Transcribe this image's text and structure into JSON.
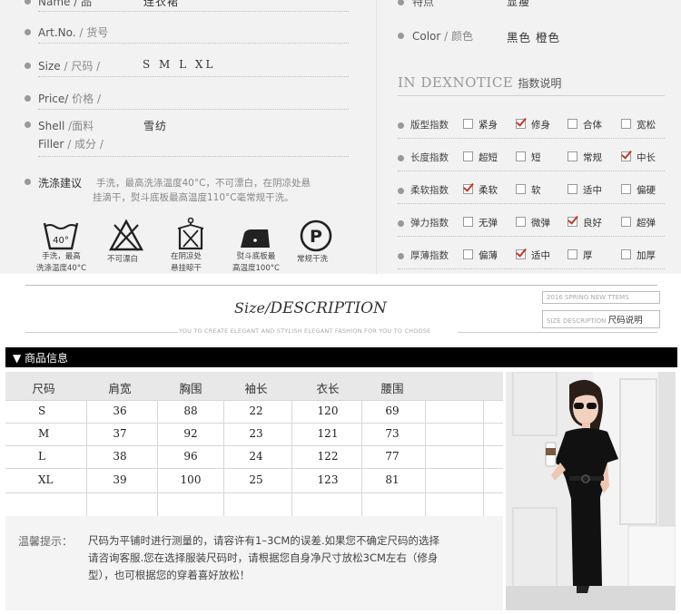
{
  "details": {
    "name_label": "Name / 品",
    "name_value": "连衣裙",
    "artno_label": "Art.No.",
    "artno_cn": "/ 货号",
    "size_label": "Size",
    "size_cn": "/ 尺码 /",
    "size_value": "S M L XL",
    "price_label": "Price/",
    "price_cn": "价格 /",
    "shell_label": "Shell",
    "shell_cn": "/面料",
    "shell_value": "雪纺",
    "filler_label": "Filler",
    "filler_cn": "/ 成分 /",
    "wash_label": "洗涤建议",
    "wash_text_1": "手洗，最高洗涤温度40°C，不可漂白，在阴凉处悬",
    "wash_text_2": "挂滴干，熨斗底板最高温度110°C毫常规干洗。",
    "care": [
      {
        "icon": "hand-wash-40-icon",
        "temp": "40°",
        "text_1": "手洗，最高",
        "text_2": "洗涤温度40°C"
      },
      {
        "icon": "no-bleach-icon",
        "text_1": "不可漂白",
        "text_2": ""
      },
      {
        "icon": "hang-dry-icon",
        "text_1": "在阴凉处",
        "text_2": "悬挂晾干"
      },
      {
        "icon": "iron-icon",
        "text_1": "熨斗底板最",
        "text_2": "高温度100°C"
      },
      {
        "icon": "dry-clean-icon",
        "letter": "P",
        "text_1": "常规干洗",
        "text_2": ""
      }
    ]
  },
  "right": {
    "feature_label": "特点",
    "feature_value": "显瘦",
    "color_label": "Color",
    "color_cn": "/ 颜色",
    "color_value": "黑色 橙色",
    "index_title_en": "IN DEXNOTICE",
    "index_title_cn": "指数说明",
    "indices": [
      {
        "label": "版型指数",
        "options": [
          "紧身",
          "修身",
          "合体",
          "宽松"
        ],
        "selected": 1
      },
      {
        "label": "长度指数",
        "options": [
          "超短",
          "短",
          "常规",
          "中长"
        ],
        "selected": 3
      },
      {
        "label": "柔软指数",
        "options": [
          "柔软",
          "软",
          "适中",
          "偏硬"
        ],
        "selected": 0
      },
      {
        "label": "弹力指数",
        "options": [
          "无弹",
          "微弹",
          "良好",
          "超弹"
        ],
        "selected": 2
      },
      {
        "label": "厚薄指数",
        "options": [
          "偏薄",
          "适中",
          "厚",
          "加厚"
        ],
        "selected": 1
      }
    ]
  },
  "size_section": {
    "title_prefix": "Size",
    "title_main": "DESCRIPTION",
    "subtitle": "YOU TO CREATE ELEGANT AND STYLISH ELEGANT FASHION FOR YOU TO CHOOSE",
    "tag_1": "2016 SPRING NEW TTEMS",
    "tag_2_en": "SIZE DESCRIPTION",
    "tag_2_cn": "尺码说明",
    "bar_title": "▼ 商品信息"
  },
  "table": {
    "headers": [
      "尺码",
      "肩宽",
      "胸围",
      "袖长",
      "衣长",
      "腰围"
    ],
    "rows": [
      [
        "S",
        "36",
        "88",
        "22",
        "120",
        "69"
      ],
      [
        "M",
        "37",
        "92",
        "23",
        "121",
        "73"
      ],
      [
        "L",
        "38",
        "96",
        "24",
        "122",
        "77"
      ],
      [
        "XL",
        "39",
        "100",
        "25",
        "123",
        "81"
      ]
    ]
  },
  "tip": {
    "label": "温馨提示：",
    "line_1": "尺码为平铺时进行测量的，请容许有1–3CM的误差.如果您不确定尺码的选择",
    "line_2": "请咨询客服.您在选择服装尺码时，请根据您自身净尺寸放松3CM左右（修身",
    "line_3": "型），也可根据您的穿着喜好放松！"
  },
  "colors": {
    "accent_check": "#c0392b",
    "bar_bg": "#000000",
    "panel_bg": "#f2f2f2"
  }
}
